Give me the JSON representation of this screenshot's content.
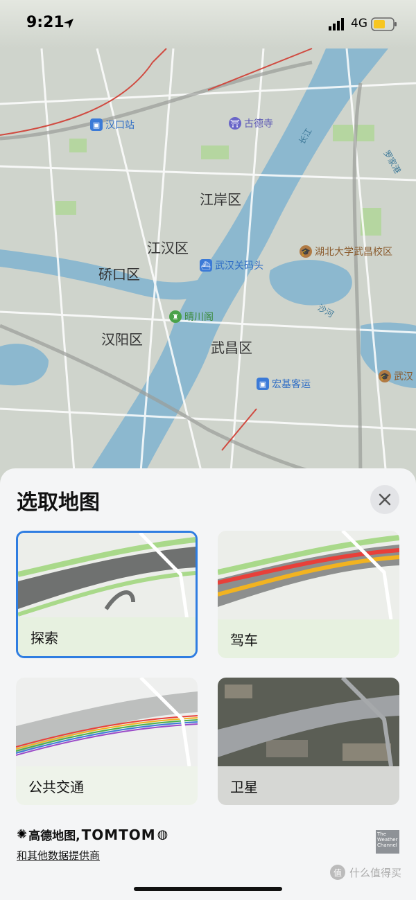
{
  "status_bar": {
    "time": "9:21",
    "network": "4G"
  },
  "map": {
    "districts": [
      "江岸区",
      "江汉区",
      "硚口区",
      "汉阳区",
      "武昌区"
    ],
    "pois": {
      "hankou_station": "汉口站",
      "gude_temple": "古德寺",
      "wuhan_pier": "武汉关码头",
      "hubei_univ": "湖北大学武昌校区",
      "qingchuan": "晴川阁",
      "hongji_bus": "宏基客运",
      "wuhan_cut": "武汉"
    },
    "water_labels": {
      "changjiang": "长江",
      "shahe": "沙河",
      "road": "罗家港"
    }
  },
  "sheet": {
    "title": "选取地图",
    "options": [
      {
        "label": "探索",
        "selected": true
      },
      {
        "label": "驾车",
        "selected": false
      },
      {
        "label": "公共交通",
        "selected": false
      },
      {
        "label": "卫星",
        "selected": false
      }
    ],
    "attribution": {
      "amap": "高德地图,",
      "tomtom": "TOMTOM"
    },
    "provider_link": "和其他数据提供商",
    "weather_badge": "The Weather Channel"
  },
  "watermark": {
    "icon": "值",
    "text": "什么值得买"
  },
  "colors": {
    "accent": "#2f7de1",
    "water": "#8cb8cf",
    "park": "#b5d6a0"
  }
}
